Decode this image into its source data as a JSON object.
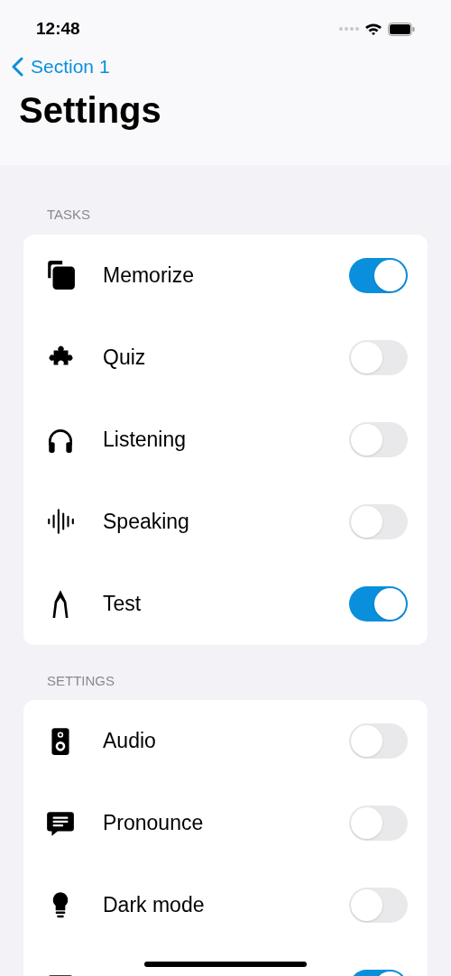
{
  "status_bar": {
    "time": "12:48"
  },
  "nav": {
    "back": "Section 1",
    "title": "Settings"
  },
  "sections": [
    {
      "header": "TASKS",
      "rows": [
        {
          "label": "Memorize",
          "on": true
        },
        {
          "label": "Quiz",
          "on": false
        },
        {
          "label": "Listening",
          "on": false
        },
        {
          "label": "Speaking",
          "on": false
        },
        {
          "label": "Test",
          "on": true
        }
      ]
    },
    {
      "header": "SETTINGS",
      "rows": [
        {
          "label": "Audio",
          "on": false
        },
        {
          "label": "Pronounce",
          "on": false
        },
        {
          "label": "Dark mode",
          "on": false
        },
        {
          "on": true
        }
      ]
    }
  ]
}
